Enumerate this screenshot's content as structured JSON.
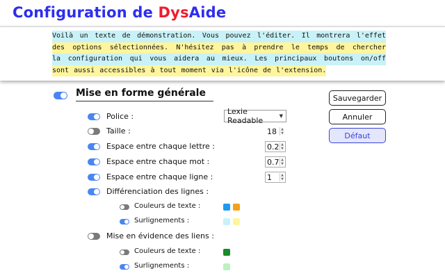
{
  "header": {
    "title_prefix": "Configuration de ",
    "title_brand_a": "Dys",
    "title_brand_b": "Aide"
  },
  "demo": {
    "lines": [
      {
        "text": "Voilà un texte de démonstration. Vous pouvez l'éditer. Il montrera l'effet",
        "highlight": "cyan"
      },
      {
        "text": "des options sélectionnées. N'hésitez pas à prendre le temps de chercher",
        "highlight": "yellow"
      },
      {
        "text": "la configuration qui vous aidera au mieux. Les principaux boutons on/off",
        "highlight": "cyan"
      },
      {
        "text": "sont aussi accessibles à tout moment via l'icône de l'extension.",
        "highlight": "yellow"
      }
    ]
  },
  "section": {
    "title": "Mise en forme générale",
    "enabled": true
  },
  "options": {
    "police": {
      "label": "Police :",
      "enabled": true,
      "value": "Lexie Readable"
    },
    "taille": {
      "label": "Taille :",
      "enabled": false,
      "value": "18"
    },
    "espace_lettre": {
      "label": "Espace entre chaque lettre :",
      "enabled": true,
      "value": "0.2"
    },
    "espace_mot": {
      "label": "Espace entre chaque mot :",
      "enabled": true,
      "value": "0.7"
    },
    "espace_ligne": {
      "label": "Espace entre chaque ligne :",
      "enabled": true,
      "value": "1"
    },
    "diff_lignes": {
      "label": "Différenciation des lignes :",
      "enabled": true,
      "couleurs": {
        "label": "Couleurs de texte :",
        "enabled": false,
        "colors": [
          "#1e9bf0",
          "#f5a11c"
        ]
      },
      "surlignements": {
        "label": "Surlignements :",
        "enabled": true,
        "colors": [
          "#c8f2f7",
          "#fff59d"
        ]
      }
    },
    "liens": {
      "label": "Mise en évidence des liens :",
      "enabled": false,
      "couleurs": {
        "label": "Couleurs de texte :",
        "enabled": false,
        "colors": [
          "#1a8a2a"
        ]
      },
      "surlignements": {
        "label": "Surlignements :",
        "enabled": true,
        "colors": [
          "#bff0c4"
        ]
      }
    }
  },
  "buttons": {
    "save": "Sauvegarder",
    "cancel": "Annuler",
    "default": "Défaut"
  }
}
